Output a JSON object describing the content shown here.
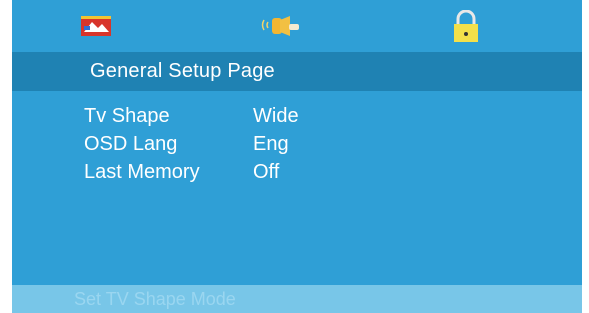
{
  "menu": {
    "tabs": [
      {
        "name": "video-settings",
        "icon": "tv-picture-icon"
      },
      {
        "name": "audio-settings",
        "icon": "speaker-icon"
      },
      {
        "name": "preference-lock",
        "icon": "padlock-icon"
      }
    ],
    "page_title": "General Setup Page",
    "settings": [
      {
        "label": "Tv Shape",
        "value": "Wide"
      },
      {
        "label": "OSD Lang",
        "value": "Eng"
      },
      {
        "label": "Last Memory",
        "value": "Off"
      }
    ],
    "status": "Set TV Shape Mode"
  },
  "colors": {
    "background": "#2f9fd6",
    "header_band": "#1f82b3",
    "status_band": "#78c6e8",
    "text": "#ffffff"
  }
}
